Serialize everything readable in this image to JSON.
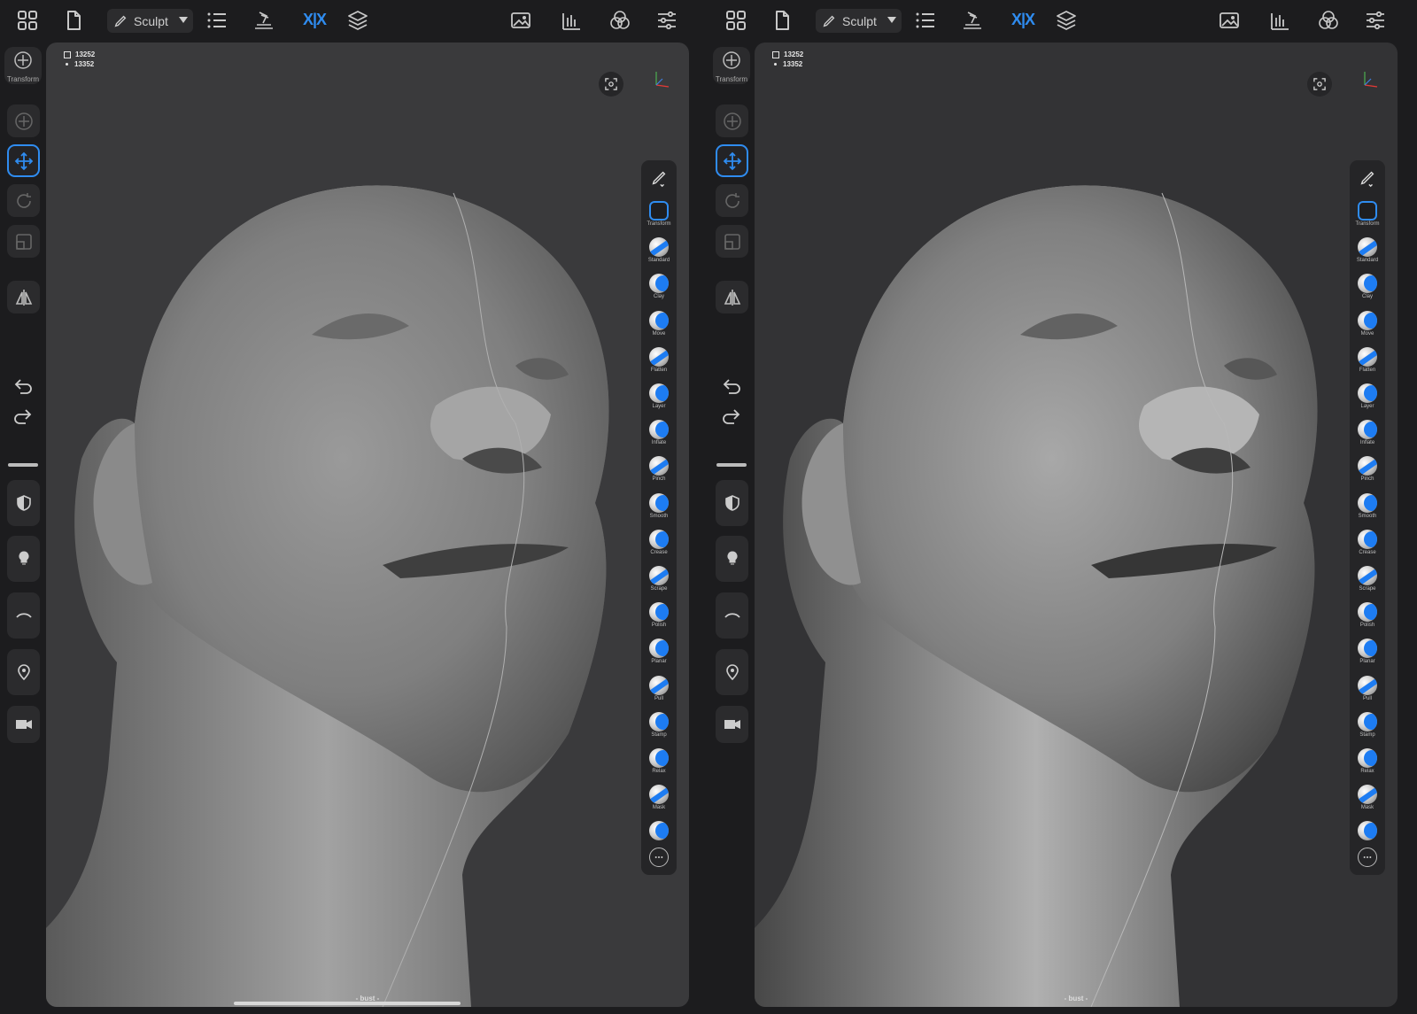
{
  "toolbar": {
    "mode_label": "Sculpt",
    "symmetry_label": "X|X"
  },
  "sidebar": {
    "transform_label": "Transform"
  },
  "viewport": {
    "stats_faces": "13252",
    "stats_vertices": "13352",
    "mesh_name": "- bust -"
  },
  "tools": [
    {
      "label": "Transform"
    },
    {
      "label": "Standard"
    },
    {
      "label": "Clay"
    },
    {
      "label": "Move"
    },
    {
      "label": "Flatten"
    },
    {
      "label": "Layer"
    },
    {
      "label": "Inflate"
    },
    {
      "label": "Pinch"
    },
    {
      "label": "Smooth"
    },
    {
      "label": "Crease"
    },
    {
      "label": "Scrape"
    },
    {
      "label": "Polish"
    },
    {
      "label": "Planar"
    },
    {
      "label": "Pull"
    },
    {
      "label": "Stamp"
    },
    {
      "label": "Relax"
    },
    {
      "label": "Mask"
    },
    {
      "label": ""
    }
  ],
  "colors": {
    "accent": "#2f8cf0",
    "panel": "#2b2b2d",
    "viewport_left": "#3a3a3c",
    "viewport_right": "#333335"
  }
}
